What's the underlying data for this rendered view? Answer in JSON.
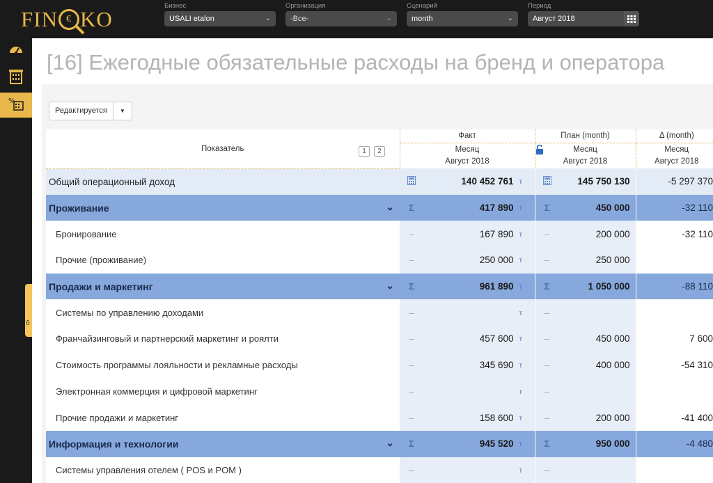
{
  "brand": {
    "logo_left": "FIN",
    "logo_right": "KO",
    "logo_mark": "€"
  },
  "filters": [
    {
      "label": "Бизнес",
      "value": "USALI etalon"
    },
    {
      "label": "Организация",
      "value": "-Все-"
    },
    {
      "label": "Сценарий",
      "value": "month"
    },
    {
      "label": "Период",
      "value": "Август 2018"
    }
  ],
  "page_title": "[16] Ежегодные обязательные расходы на бренд и оператора",
  "edit_button": "Редактируется",
  "side_tab": "б",
  "table": {
    "header": {
      "indicator": "Показатель",
      "pages": [
        "1",
        "2"
      ],
      "fact": "Факт",
      "plan": "План (month)",
      "delta": "Δ (month)",
      "month": "Месяц",
      "period": "Август 2018"
    },
    "unit": "т",
    "rows": [
      {
        "type": "op",
        "name": "Общий операционный доход",
        "fact": "140 452 761",
        "plan": "145 750 130",
        "delta": "-5 297 370"
      },
      {
        "type": "grp",
        "name": "Проживание",
        "fact": "417 890",
        "plan": "450 000",
        "delta": "-32 110"
      },
      {
        "type": "sub",
        "name": "Бронирование",
        "fact": "167 890",
        "plan": "200 000",
        "delta": "-32 110"
      },
      {
        "type": "sub",
        "name": "Прочие (проживание)",
        "fact": "250 000",
        "plan": "250 000",
        "delta": ""
      },
      {
        "type": "grp",
        "name": "Продажи и маркетинг",
        "fact": "961 890",
        "plan": "1 050 000",
        "delta": "-88 110"
      },
      {
        "type": "sub",
        "name": "Системы по управлению доходами",
        "fact": "",
        "plan": "",
        "delta": ""
      },
      {
        "type": "sub",
        "name": "Франчайзинговый и партнерский маркетинг и роялти",
        "fact": "457 600",
        "plan": "450 000",
        "delta": "7 600"
      },
      {
        "type": "sub",
        "name": "Стоимость программы лояльности и рекламные расходы",
        "fact": "345 690",
        "plan": "400 000",
        "delta": "-54 310"
      },
      {
        "type": "sub",
        "name": "Электронная коммерция и цифровой маркетинг",
        "fact": "",
        "plan": "",
        "delta": ""
      },
      {
        "type": "sub",
        "name": "Прочие продажи и маркетинг",
        "fact": "158 600",
        "plan": "200 000",
        "delta": "-41 400"
      },
      {
        "type": "grp",
        "name": "Информация и технологии",
        "fact": "945 520",
        "plan": "950 000",
        "delta": "-4 480"
      },
      {
        "type": "sub",
        "name": "Системы управления отелем ( POS и POM )",
        "fact": "",
        "plan": "",
        "delta": ""
      }
    ]
  }
}
